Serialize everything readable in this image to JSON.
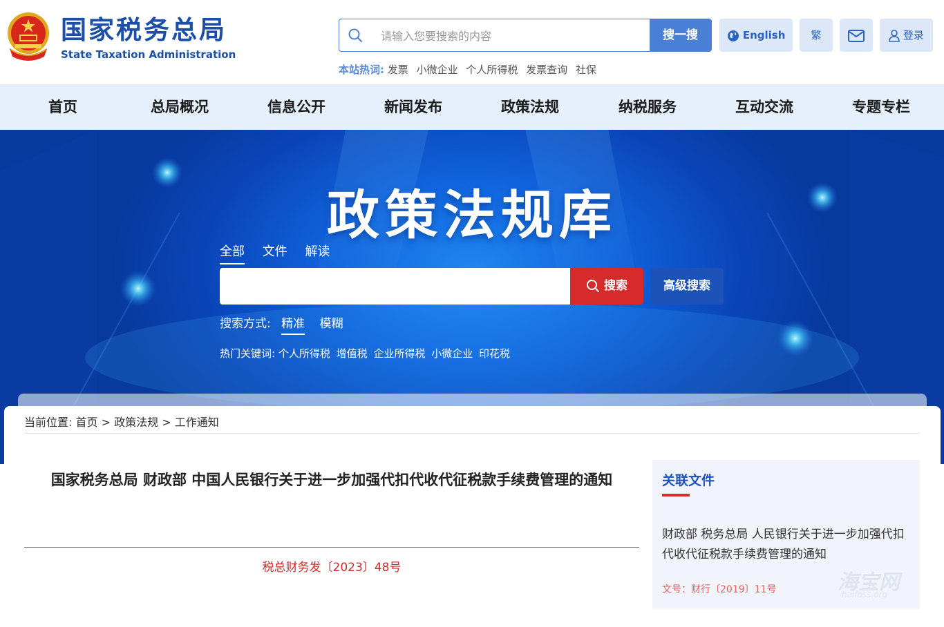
{
  "header": {
    "brand_cn": "国家税务总局",
    "brand_en": "State Taxation Administration",
    "search": {
      "placeholder": "请输入您要搜索的内容",
      "button": "搜一搜"
    },
    "hot_label": "本站热词:",
    "hot_words": [
      "发票",
      "小微企业",
      "个人所得税",
      "发票查询",
      "社保"
    ],
    "english_label": "English",
    "traditional_label": "繁",
    "login_label": "登录"
  },
  "nav": [
    "首页",
    "总局概况",
    "信息公开",
    "新闻发布",
    "政策法规",
    "纳税服务",
    "互动交流",
    "专题专栏"
  ],
  "banner": {
    "title": "政策法规库",
    "tabs": [
      "全部",
      "文件",
      "解读"
    ],
    "search_button": "搜索",
    "advanced_button": "高级搜索",
    "mode_label": "搜索方式:",
    "modes": [
      "精准",
      "模糊"
    ],
    "hot_label": "热门关键词:",
    "hot_words": [
      "个人所得税",
      "增值税",
      "企业所得税",
      "小微企业",
      "印花税"
    ]
  },
  "breadcrumb": {
    "label": "当前位置:",
    "items": [
      "首页",
      "政策法规",
      "工作通知"
    ],
    "separator": ">"
  },
  "document": {
    "title": "国家税务总局 财政部 中国人民银行关于进一步加强代扣代收代征税款手续费管理的通知",
    "number": "税总财务发〔2023〕48号"
  },
  "sidebar": {
    "heading": "关联文件",
    "link": "财政部 税务总局 人民银行关于进一步加强代扣代收代征税款手续费管理的通知",
    "doc_number": "文号：财行〔2019〕11号"
  },
  "watermark": {
    "main": "海宝网",
    "sub": "haifoss.org"
  },
  "colors": {
    "brand_blue": "#1b4fa8",
    "accent_blue": "#4a7fd6",
    "nav_bg": "#e6f0fc",
    "red": "#d52b2b",
    "dark_blue": "#1d52b8"
  }
}
